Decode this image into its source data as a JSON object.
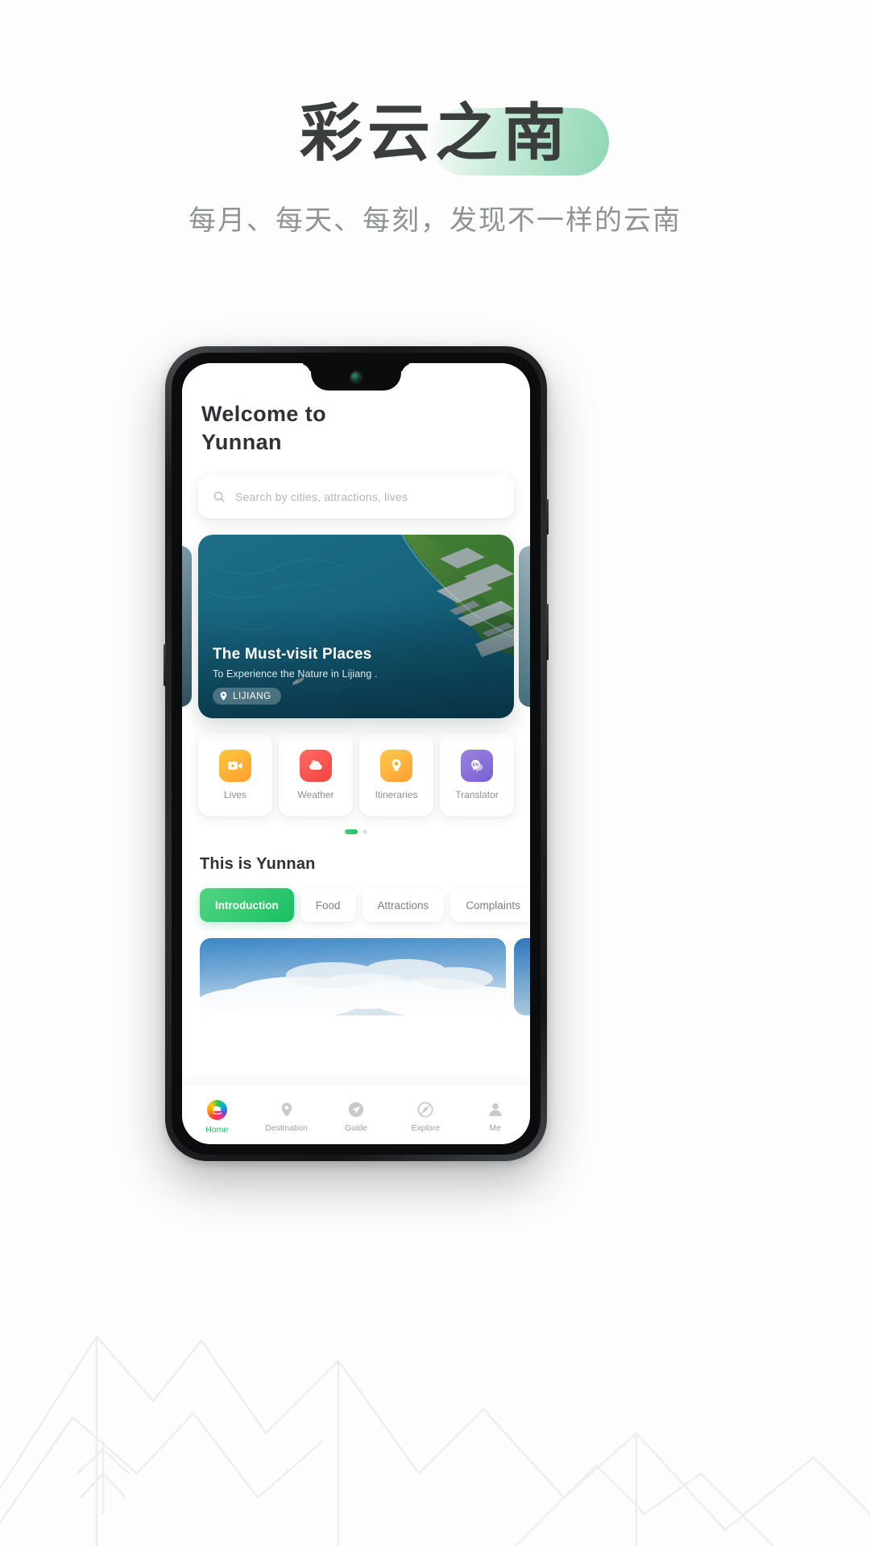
{
  "poster": {
    "title": "彩云之南",
    "subtitle": "每月、每天、每刻，发现不一样的云南",
    "accent_color": "#19bf63",
    "pill_color": "#8fd6b4"
  },
  "app": {
    "header": {
      "welcome": "Welcome  to\nYunnan"
    },
    "search": {
      "placeholder": "Search by cities, attractions, lives",
      "icon": "search-icon"
    },
    "carousel": {
      "card": {
        "title": "The Must-visit Places",
        "subtitle": "To Experience the Nature in Lijiang .",
        "badge": "LIJIANG",
        "badge_icon": "location-pin-icon"
      },
      "dots": {
        "active_index": 0,
        "count": 2
      }
    },
    "quick_actions": [
      {
        "label": "Lives",
        "icon": "video-camera-icon",
        "color": "#ffb13a"
      },
      {
        "label": "Weather",
        "icon": "cloud-icon",
        "color": "#f54a44"
      },
      {
        "label": "Itineraries",
        "icon": "location-pin-icon",
        "color": "#ffb13a"
      },
      {
        "label": "Translator",
        "icon": "translate-bubble-icon",
        "badge": "EN",
        "color": "#8a6cd8"
      }
    ],
    "section": {
      "title": "This is Yunnan",
      "tabs": [
        {
          "label": "Introduction",
          "active": true
        },
        {
          "label": "Food",
          "active": false
        },
        {
          "label": "Attractions",
          "active": false
        },
        {
          "label": "Complaints",
          "active": false
        }
      ]
    },
    "bottom_nav": [
      {
        "label": "Home",
        "icon": "home-logo-icon",
        "active": true
      },
      {
        "label": "Destination",
        "icon": "location-pin-icon",
        "active": false
      },
      {
        "label": "Guide",
        "icon": "paper-plane-icon",
        "active": false
      },
      {
        "label": "Explore",
        "icon": "compass-leaf-icon",
        "active": false
      },
      {
        "label": "Me",
        "icon": "person-icon",
        "active": false
      }
    ]
  }
}
